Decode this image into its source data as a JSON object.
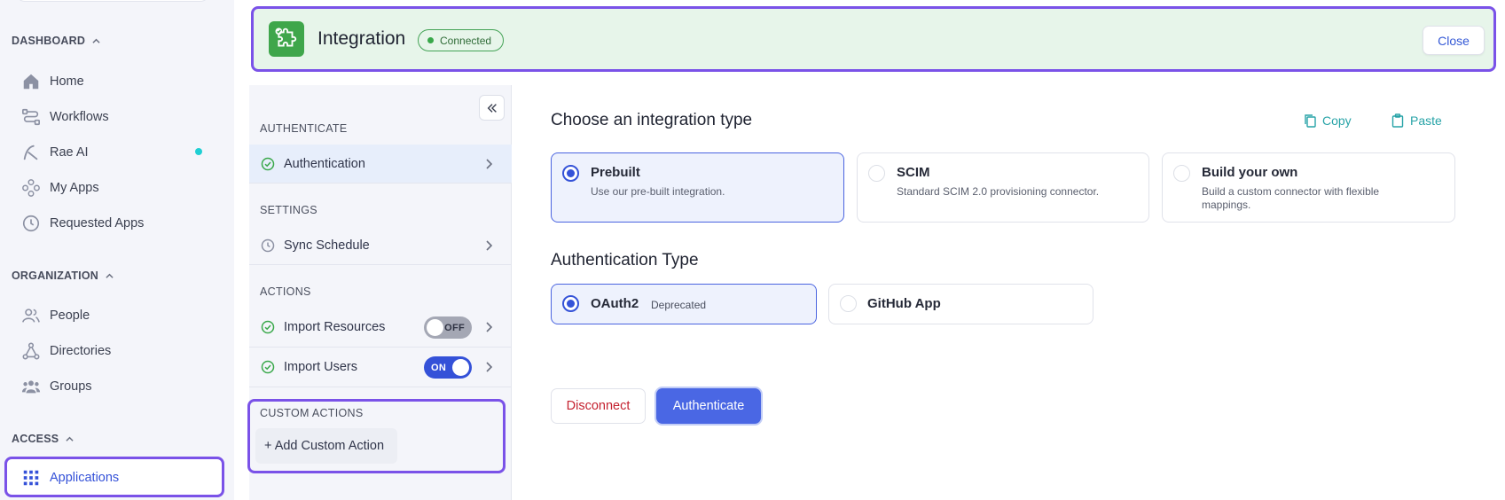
{
  "sidebar": {
    "sections": [
      {
        "title": "DASHBOARD",
        "items": [
          {
            "label": "Home",
            "icon": "home-icon"
          },
          {
            "label": "Workflows",
            "icon": "workflows-icon"
          },
          {
            "label": "Rae AI",
            "icon": "rae-ai-icon",
            "indicator": "new-dot"
          },
          {
            "label": "My Apps",
            "icon": "my-apps-icon"
          },
          {
            "label": "Requested Apps",
            "icon": "clock-icon"
          }
        ]
      },
      {
        "title": "ORGANIZATION",
        "items": [
          {
            "label": "People",
            "icon": "people-icon"
          },
          {
            "label": "Directories",
            "icon": "directories-icon"
          },
          {
            "label": "Groups",
            "icon": "groups-icon"
          }
        ]
      },
      {
        "title": "ACCESS",
        "items": [
          {
            "label": "Applications",
            "icon": "grid-icon",
            "active": true
          }
        ]
      }
    ]
  },
  "header": {
    "title": "Integration",
    "status": "Connected",
    "close_label": "Close"
  },
  "settings": {
    "authenticate_label": "AUTHENTICATE",
    "authentication": "Authentication",
    "settings_label": "SETTINGS",
    "sync_schedule": "Sync Schedule",
    "actions_label": "ACTIONS",
    "import_resources": "Import Resources",
    "import_resources_toggle": "OFF",
    "import_users": "Import Users",
    "import_users_toggle": "ON",
    "custom_actions_label": "CUSTOM ACTIONS",
    "add_custom_action": "+ Add Custom Action"
  },
  "main": {
    "integration_type_heading": "Choose an integration type",
    "copy_label": "Copy",
    "paste_label": "Paste",
    "integration_types": [
      {
        "title": "Prebuilt",
        "desc": "Use our pre-built integration.",
        "selected": true
      },
      {
        "title": "SCIM",
        "desc": "Standard SCIM 2.0 provisioning connector.",
        "selected": false
      },
      {
        "title": "Build your own",
        "desc": "Build a custom connector with flexible mappings.",
        "selected": false
      }
    ],
    "auth_type_heading": "Authentication Type",
    "auth_types": [
      {
        "title": "OAuth2",
        "tag": "Deprecated",
        "selected": true
      },
      {
        "title": "GitHub App",
        "selected": false
      }
    ],
    "disconnect_label": "Disconnect",
    "authenticate_label": "Authenticate"
  },
  "colors": {
    "accent_blue": "#3451d8",
    "highlight_purple": "#7a52e8",
    "connected_green": "#39a84a",
    "teal": "#27a3a7",
    "danger_red": "#c4212f"
  }
}
